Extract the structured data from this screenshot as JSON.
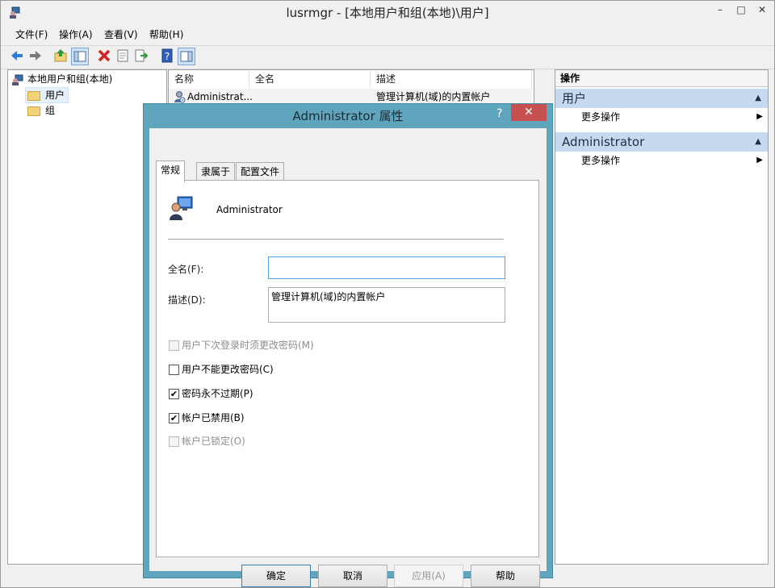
{
  "window": {
    "title": "lusrmgr - [本地用户和组(本地)\\用户]",
    "controls": {
      "minimize": "–",
      "maximize": "□",
      "close": "✕"
    }
  },
  "menubar": [
    "文件(F)",
    "操作(A)",
    "查看(V)",
    "帮助(H)"
  ],
  "toolbar": {
    "icons": [
      "back-arrow-icon",
      "forward-arrow-icon",
      "up-folder-icon",
      "show-tree-icon",
      "delete-icon",
      "properties-icon",
      "export-icon",
      "help-icon",
      "show-action-pane-icon"
    ]
  },
  "tree": {
    "root": "本地用户和组(本地)",
    "items": [
      "用户",
      "组"
    ]
  },
  "list": {
    "columns": [
      "名称",
      "全名",
      "描述"
    ],
    "rows": [
      {
        "name": "Administrat...",
        "fullname": "",
        "description": "管理计算机(域)的内置帐户"
      }
    ]
  },
  "actions": {
    "title": "操作",
    "groups": [
      {
        "name": "用户",
        "items": [
          "更多操作"
        ]
      },
      {
        "name": "Administrator",
        "items": [
          "更多操作"
        ]
      }
    ]
  },
  "dialog": {
    "title": "Administrator 属性",
    "help": "?",
    "close": "✕",
    "tabs": [
      "常规",
      "隶属于",
      "配置文件"
    ],
    "active_tab": "常规",
    "username": "Administrator",
    "fullname_label": "全名(F):",
    "fullname_value": "",
    "description_label": "描述(D):",
    "description_value": "管理计算机(域)的内置帐户",
    "checkboxes": [
      {
        "label": "用户下次登录时须更改密码(M)",
        "checked": false,
        "enabled": false
      },
      {
        "label": "用户不能更改密码(C)",
        "checked": false,
        "enabled": true
      },
      {
        "label": "密码永不过期(P)",
        "checked": true,
        "enabled": true
      },
      {
        "label": "帐户已禁用(B)",
        "checked": true,
        "enabled": true
      },
      {
        "label": "帐户已锁定(O)",
        "checked": false,
        "enabled": false
      }
    ],
    "buttons": {
      "ok": "确定",
      "cancel": "取消",
      "apply": "应用(A)",
      "help": "帮助"
    },
    "check_mark": "✔"
  },
  "colors": {
    "dialog_frame": "#5ea5bd",
    "action_group_bg": "#c5d9ef",
    "close_button": "#c75050"
  }
}
